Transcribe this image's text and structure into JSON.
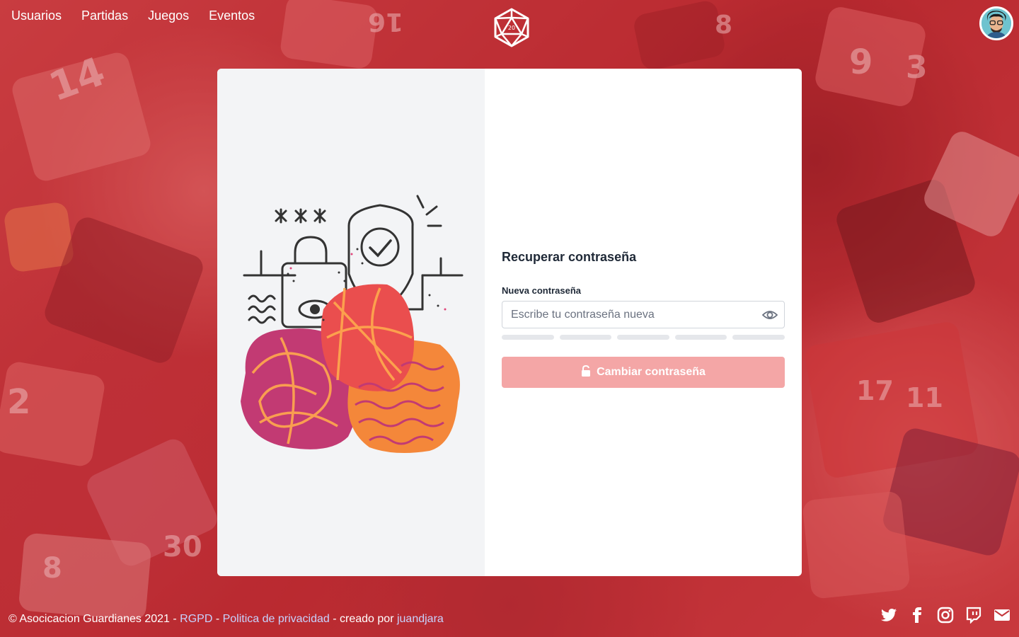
{
  "nav": {
    "items": [
      {
        "label": "Usuarios"
      },
      {
        "label": "Partidas"
      },
      {
        "label": "Juegos"
      },
      {
        "label": "Eventos"
      }
    ]
  },
  "logo": {
    "icon": "d20-icon",
    "number": "20"
  },
  "avatar": {
    "icon": "user-avatar"
  },
  "form": {
    "title": "Recuperar contraseña",
    "password_label": "Nueva contraseña",
    "password_placeholder": "Escribe tu contraseña nueva",
    "password_value": "",
    "toggle_icon": "eye-icon",
    "strength_segments": 5,
    "submit_label": "Cambiar contraseña",
    "submit_icon": "unlock-icon"
  },
  "footer": {
    "copyright": "© Asocicacion Guardianes 2021 - ",
    "rgpd": "RGPD",
    "sep1": " - ",
    "privacy": "Politica de privacidad",
    "created_by": " - creado por ",
    "author": "juandjara"
  },
  "social": [
    "twitter-icon",
    "facebook-icon",
    "instagram-icon",
    "twitch-icon",
    "mail-icon"
  ],
  "colors": {
    "accent": "#f4a6a6",
    "background": "#c4363a",
    "link": "#c7d2fe"
  }
}
